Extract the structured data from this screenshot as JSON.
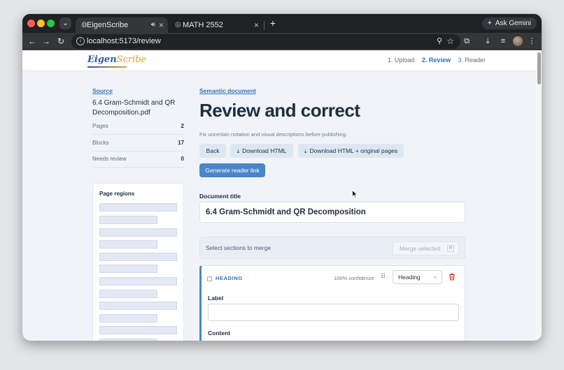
{
  "browser": {
    "tabs": [
      {
        "title": "EigenScribe",
        "active": true,
        "audio_icon": "speaker-icon"
      },
      {
        "title": "MATH 2552",
        "active": false
      }
    ],
    "new_tab_label": "+",
    "gemini_label": "Ask Gemini",
    "url": "localhost:5173/review"
  },
  "app": {
    "logo_main": "Eigen",
    "logo_rest": "Scribe",
    "steps": [
      "1. Upload",
      "2. Review",
      "3. Reader"
    ],
    "current_step": "2. Review"
  },
  "sidebar": {
    "source_link": "Source",
    "filename": "6.4 Gram-Schmidt and QR Decomposition.pdf",
    "stats": [
      {
        "label": "Pages",
        "value": "2"
      },
      {
        "label": "Blocks",
        "value": "17"
      },
      {
        "label": "Needs review",
        "value": "0"
      }
    ],
    "regions_title": "Page regions"
  },
  "main": {
    "semantic_link": "Semantic document",
    "title": "Review and correct",
    "subtitle": "Fix uncertain notation and visual descriptions before publishing.",
    "buttons": {
      "back": "Back",
      "download_html": "Download HTML",
      "download_html_pages": "Download HTML + original pages",
      "generate_link": "Generate reader link"
    },
    "doc_title_label": "Document title",
    "doc_title_value": "6.4 Gram-Schmidt and QR Decomposition",
    "merge_prompt": "Select sections to merge",
    "merge_button": "Merge selected",
    "merge_shortcut": "R"
  },
  "block": {
    "kind": "HEADING",
    "confidence": "100% confidence",
    "type_select": "Heading",
    "label_field": "Label",
    "label_value": "",
    "content_field": "Content"
  },
  "colors": {
    "accent": "#3572b8",
    "primary_button": "#4a86c9",
    "page_bg": "#f0f4f8",
    "delete": "#d93025"
  }
}
